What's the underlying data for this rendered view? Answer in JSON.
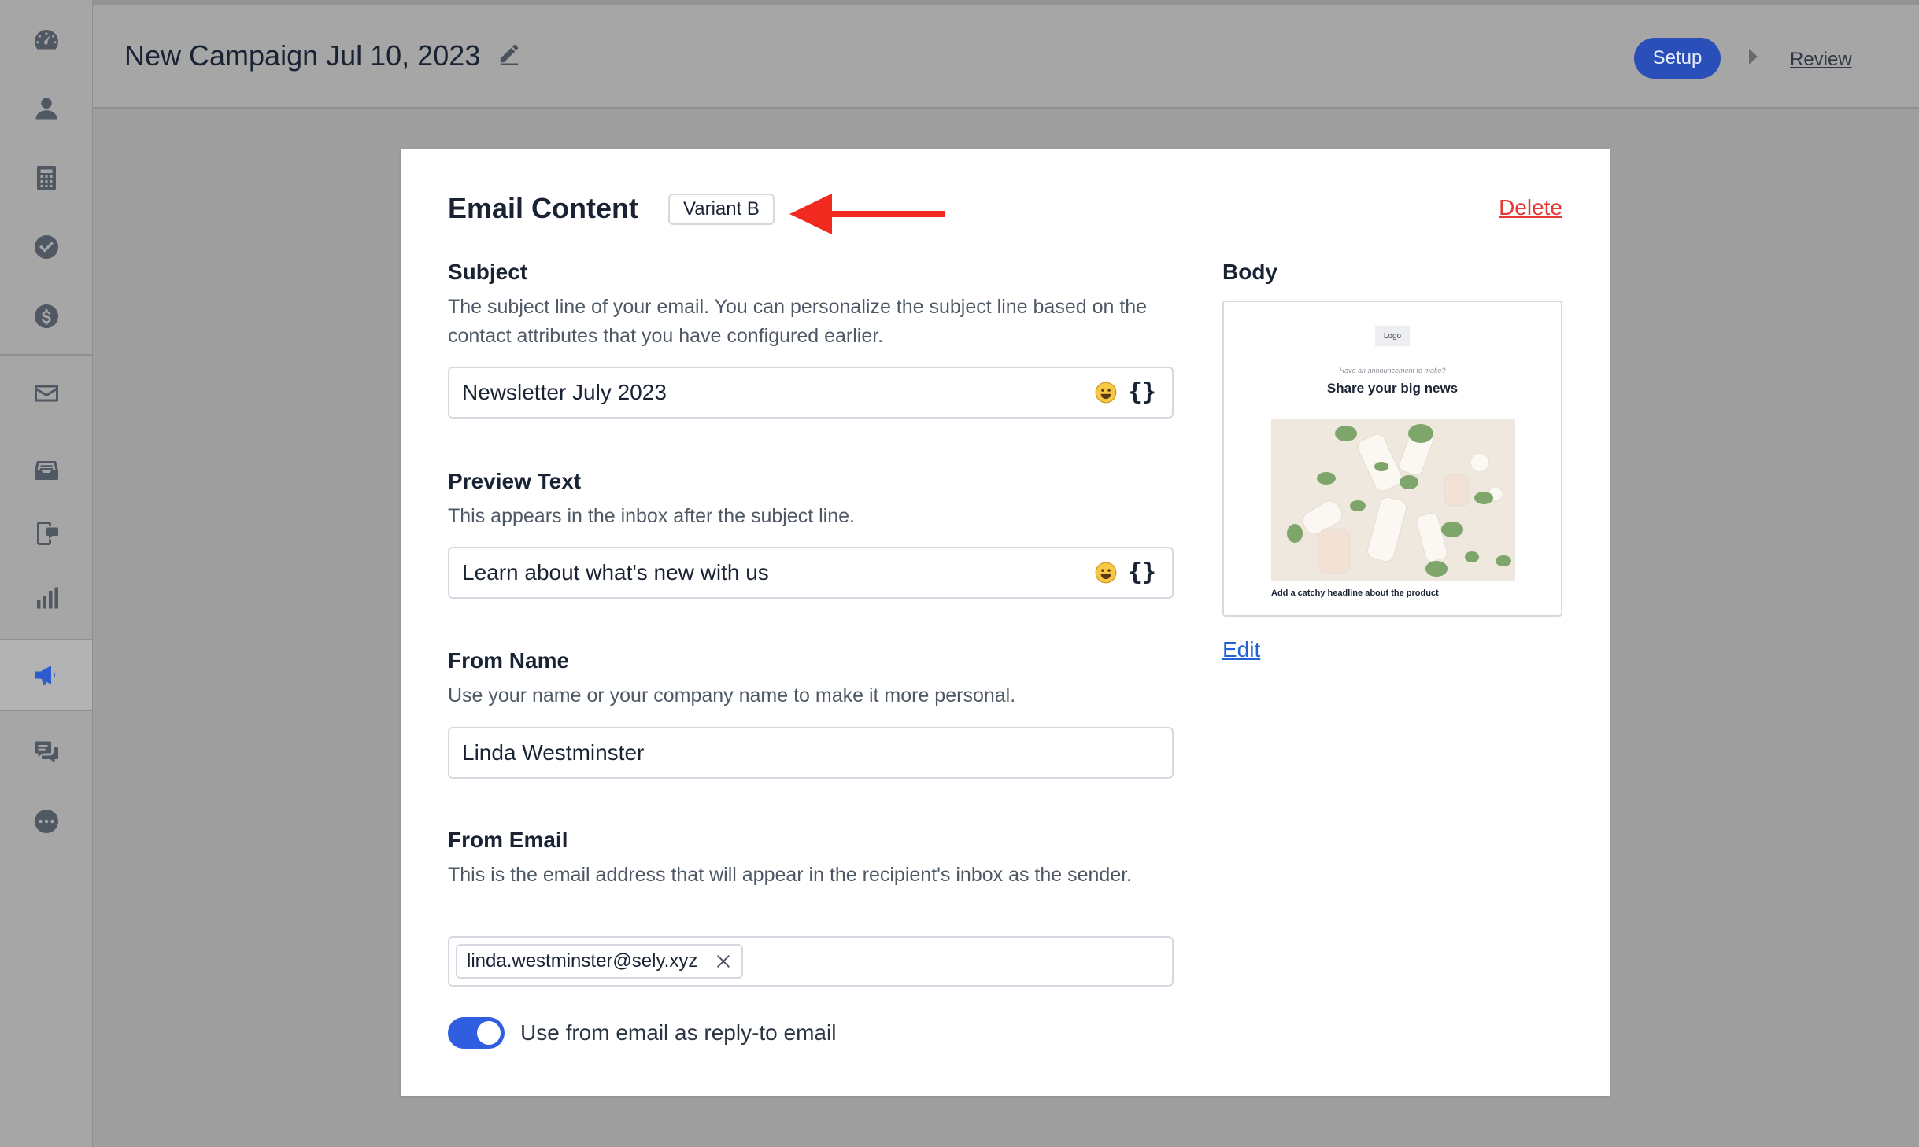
{
  "sidebar": {
    "items": [
      {
        "icon": "dashboard-gauge-icon"
      },
      {
        "icon": "user-icon"
      },
      {
        "icon": "calculator-icon"
      },
      {
        "icon": "check-circle-icon"
      },
      {
        "icon": "dollar-circle-icon"
      },
      {
        "icon": "mail-icon"
      },
      {
        "icon": "inbox-icon"
      },
      {
        "icon": "phone-chat-icon"
      },
      {
        "icon": "bar-chart-icon"
      },
      {
        "icon": "megaphone-icon",
        "active": true
      },
      {
        "icon": "chat-bubbles-icon"
      },
      {
        "icon": "more-circle-icon"
      }
    ]
  },
  "header": {
    "title": "New Campaign Jul 10, 2023",
    "steps": {
      "setup": "Setup",
      "review": "Review"
    }
  },
  "card": {
    "title": "Email Content",
    "variant": "Variant B",
    "delete_label": "Delete",
    "subject": {
      "label": "Subject",
      "description": "The subject line of your email. You can personalize the subject line based on the contact attributes that you have configured earlier.",
      "value": "Newsletter July 2023"
    },
    "preview_text": {
      "label": "Preview Text",
      "description": "This appears in the inbox after the subject line.",
      "value": "Learn about what's new with us"
    },
    "from_name": {
      "label": "From Name",
      "description": "Use your name or your company name to make it more personal.",
      "value": "Linda Westminster"
    },
    "from_email": {
      "label": "From Email",
      "description": "This is the email address that will appear in the recipient's inbox as the sender.",
      "chip": "linda.westminster@sely.xyz"
    },
    "reply_to": {
      "label": "Use from email as reply-to email",
      "enabled": true
    },
    "body": {
      "label": "Body",
      "preview": {
        "logo": "Logo",
        "announcement": "Have an announcement to make?",
        "headline": "Share your big news",
        "caption": "Add a catchy headline about the product"
      },
      "edit_label": "Edit"
    }
  },
  "colors": {
    "accent": "#2f5fe0",
    "danger": "#e53935",
    "link": "#1f63d6",
    "arrow": "#f02a1e"
  }
}
